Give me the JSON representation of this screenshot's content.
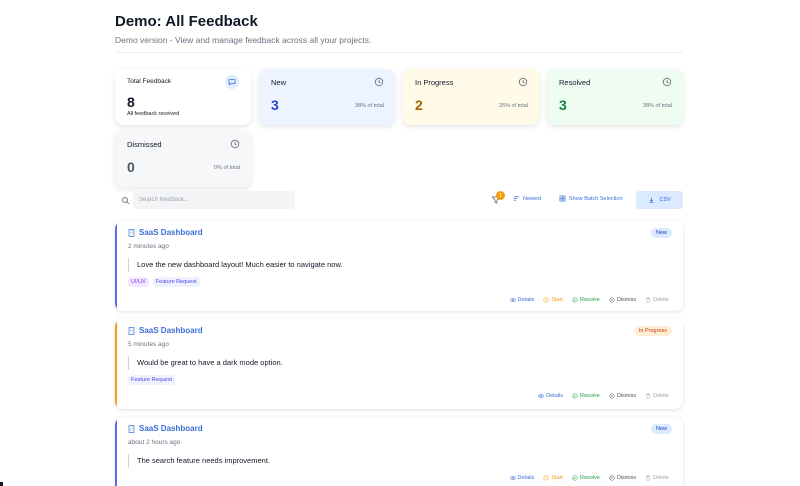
{
  "header": {
    "title": "Demo: All Feedback",
    "subtitle": "Demo version - View and manage feedback across all your projects."
  },
  "stats": {
    "total": {
      "label": "Total Feedback",
      "value": "8",
      "desc": "All feedback received",
      "icon": "message-icon"
    },
    "new": {
      "label": "New",
      "value": "3",
      "pct": "38% of total",
      "icon": "clock-icon"
    },
    "in_progress": {
      "label": "In Progress",
      "value": "2",
      "pct": "25% of total",
      "icon": "clock-icon"
    },
    "resolved": {
      "label": "Resolved",
      "value": "3",
      "pct": "38% of total",
      "icon": "clock-icon"
    },
    "dismissed": {
      "label": "Dismissed",
      "value": "0",
      "pct": "0% of total",
      "icon": "clock-icon"
    }
  },
  "toolbar": {
    "search_placeholder": "Search feedback...",
    "filter_count": "1",
    "sort_label": "Newest",
    "batch_label": "Show Batch Selection",
    "csv_label": "CSV"
  },
  "actions": {
    "details": "Details",
    "start": "Start",
    "resolve": "Resolve",
    "dismiss": "Dismiss",
    "delete": "Delete"
  },
  "feedback": [
    {
      "project": "SaaS Dashboard",
      "time": "2 minutes ago",
      "message": "Love the new dashboard layout! Much easier to navigate now.",
      "tags": [
        "UI/UX",
        "Feature Request"
      ],
      "status": "New"
    },
    {
      "project": "SaaS Dashboard",
      "time": "5 minutes ago",
      "message": "Would be great to have a dark mode option.",
      "tags": [
        "Feature Request"
      ],
      "status": "In Progress"
    },
    {
      "project": "SaaS Dashboard",
      "time": "about 2 hours ago",
      "message": "The search feature needs improvement.",
      "tags": [],
      "status": "New"
    }
  ],
  "colors": {
    "accent_blue": "#3b6fd6",
    "new": "#2f3fd6",
    "in_progress": "#a16207",
    "resolved": "#15803d",
    "dismissed": "#4b5563"
  }
}
